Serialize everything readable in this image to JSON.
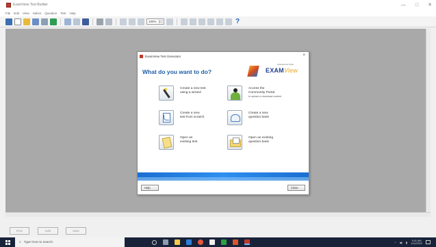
{
  "window": {
    "title": "ExamView Test Builder",
    "controls": [
      "—",
      "□",
      "✕"
    ]
  },
  "menu": [
    "File",
    "Edit",
    "View",
    "Select",
    "Question",
    "Test",
    "Help"
  ],
  "toolbar": {
    "zoom": "100%",
    "help_label": "?"
  },
  "dialog": {
    "title": "ExamView Test Generator",
    "close": "×",
    "heading": "What do you want to do?",
    "logo": {
      "small": "Assessment Suite",
      "main": "EXAM",
      "accent": "View"
    },
    "options": [
      {
        "line1": "Create a new test",
        "line2": "using a wizard",
        "small": ""
      },
      {
        "line1": "Access the",
        "line2": "Community Portal",
        "small": "to upload or download content"
      },
      {
        "line1": "Create a new",
        "line2": "test from scratch",
        "small": ""
      },
      {
        "line1": "Create a new",
        "line2": "question bank",
        "small": ""
      },
      {
        "line1": "Open an",
        "line2": "existing test",
        "small": ""
      },
      {
        "line1": "Open an existing",
        "line2": "question bank",
        "small": ""
      }
    ],
    "help_button": "Help",
    "close_button": "Close"
  },
  "bottom_nav": [
    "Prev",
    "Edit",
    "Next"
  ],
  "taskbar": {
    "search_placeholder": "Type here to search",
    "time": "5:41 AM",
    "date": "1/10/2022"
  },
  "colors": {
    "heading_blue": "#1f5ea8",
    "band_blue": "#1a6fd1",
    "workspace_gray": "#a9a9a9",
    "taskbar": "#18233a"
  }
}
